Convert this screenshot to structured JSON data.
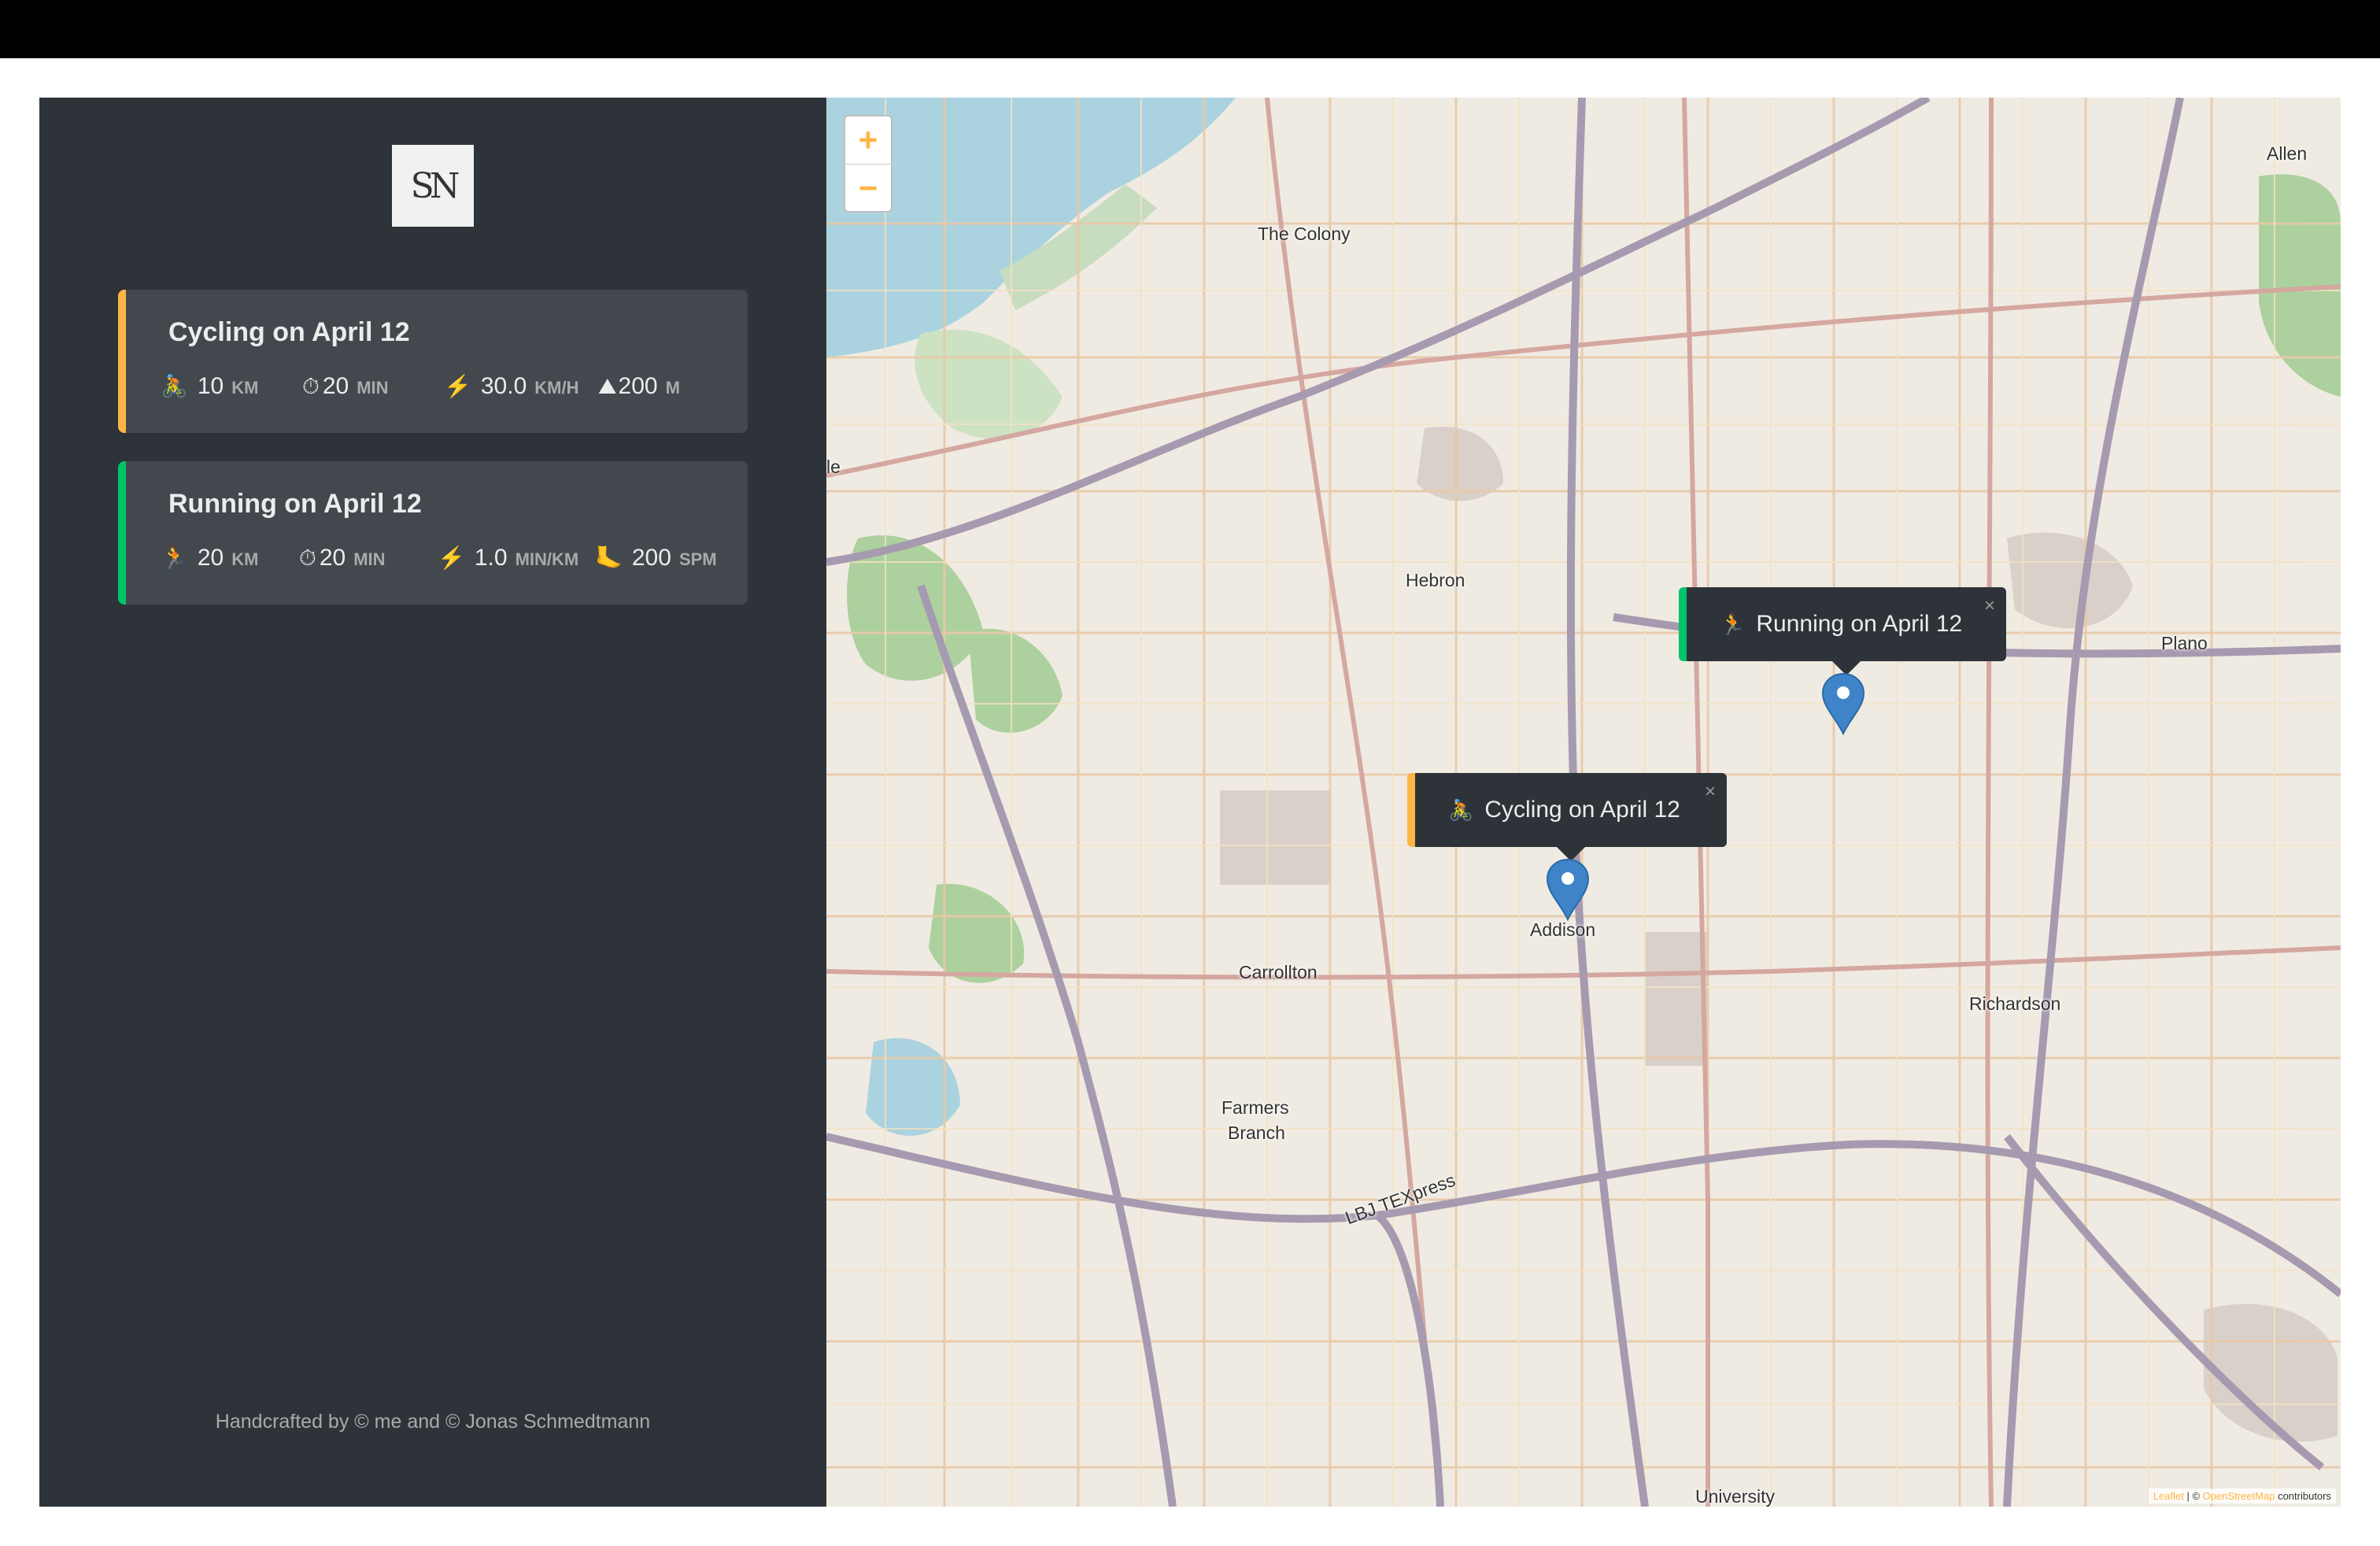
{
  "logo": {
    "text": "SN"
  },
  "workouts": [
    {
      "title": "Cycling on April 12",
      "details": [
        {
          "icon": "🚴",
          "value": "10",
          "unit": "km"
        },
        {
          "icon": "⏱",
          "value": "20",
          "unit": "min"
        },
        {
          "icon": "⚡️",
          "value": "30.0",
          "unit": "km/h"
        },
        {
          "icon": "⛰",
          "value": "200",
          "unit": "m"
        }
      ]
    },
    {
      "title": "Running on April 12",
      "details": [
        {
          "icon": "🏃",
          "value": "20",
          "unit": "km"
        },
        {
          "icon": "⏱",
          "value": "20",
          "unit": "min"
        },
        {
          "icon": "⚡️",
          "value": "1.0",
          "unit": "min/km"
        },
        {
          "icon": "🦶",
          "value": "200",
          "unit": "spm"
        }
      ]
    }
  ],
  "footer": "Handcrafted by © me and © Jonas Schmedtmann",
  "map": {
    "zoom_in": "+",
    "zoom_out": "−",
    "popups": [
      {
        "emoji": "🏃",
        "label": "Running on April 12",
        "close": "×"
      },
      {
        "emoji": "🚴",
        "label": "Cycling on April 12",
        "close": "×"
      }
    ],
    "labels": [
      "Allen",
      "The Colony",
      "Hebron",
      "Plano",
      "Addison",
      "Carrollton",
      "Richardson",
      "Farmers",
      "Branch",
      "LBJ TEXpress",
      "University",
      "le"
    ],
    "attribution": {
      "leaflet": "Leaflet",
      "sep": " | © ",
      "osm": "OpenStreetMap",
      "suffix": " contributors"
    }
  },
  "colors": {
    "cycling": "#ffb545",
    "running": "#00c46a",
    "sidebar": "#2d3338",
    "marker": "#3f83c9"
  }
}
